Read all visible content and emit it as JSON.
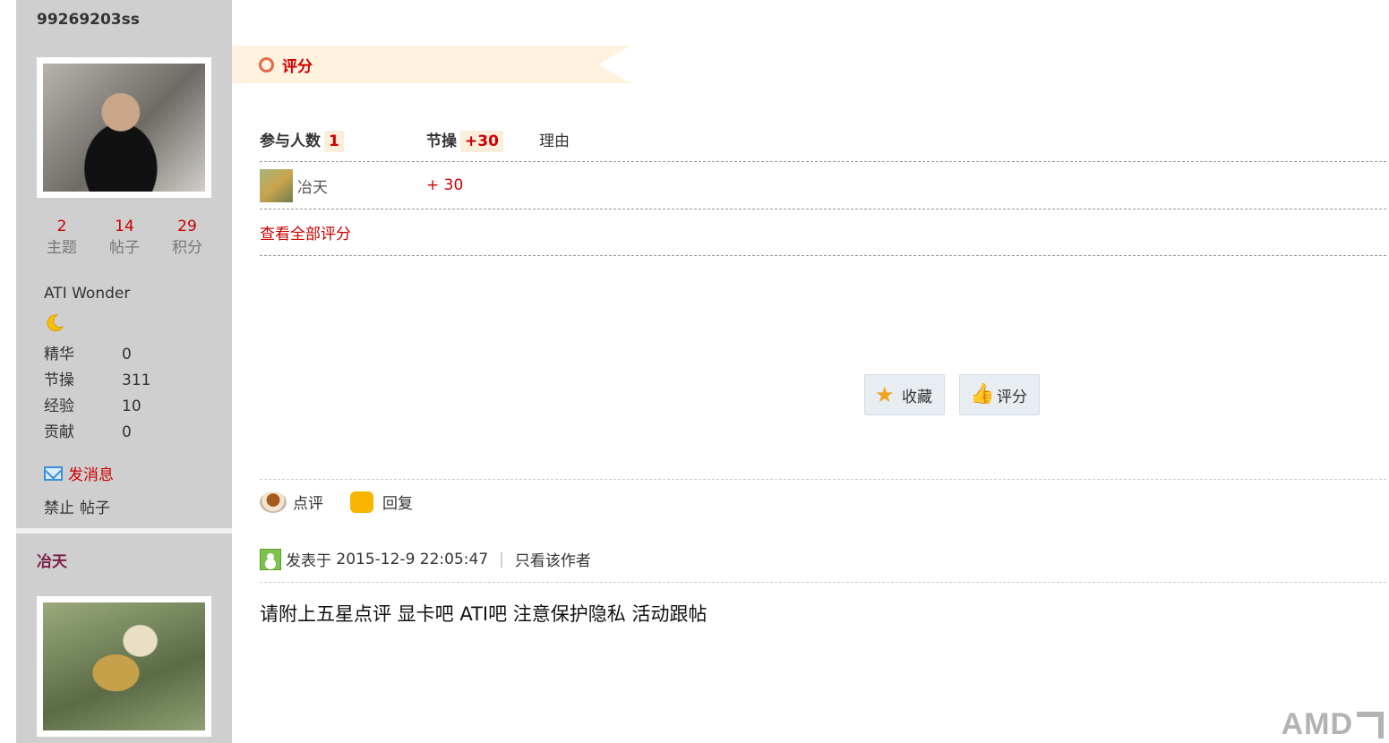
{
  "users": [
    {
      "name": "99269203ss",
      "stats": [
        {
          "value": "2",
          "label": "主题"
        },
        {
          "value": "14",
          "label": "帖子"
        },
        {
          "value": "29",
          "label": "积分"
        }
      ],
      "group": "ATI Wonder",
      "rank_icon": "moon-icon",
      "fields": [
        {
          "key": "精华",
          "value": "0"
        },
        {
          "key": "节操",
          "value": "311"
        },
        {
          "key": "经验",
          "value": "10"
        },
        {
          "key": "贡献",
          "value": "0"
        }
      ],
      "send_message": "发消息",
      "ban": "禁止",
      "posts": "帖子"
    },
    {
      "name": "冶天"
    }
  ],
  "rating": {
    "title": "评分",
    "participants_label": "参与人数",
    "participants_count": "1",
    "jiecao_label": "节操",
    "jiecao_total": "+30",
    "reason_label": "理由",
    "rows": [
      {
        "user": "冶天",
        "score": "+ 30"
      }
    ],
    "view_all": "查看全部评分"
  },
  "actions": {
    "favorite": "收藏",
    "rate": "评分",
    "comment": "点评",
    "reply": "回复"
  },
  "post2": {
    "posted_prefix": "发表于",
    "posted_time": "2015-12-9 22:05:47",
    "only_author": "只看该作者",
    "body": "请附上五星点评 显卡吧 ATI吧 注意保护隐私 活动跟帖"
  },
  "watermark": "AMD"
}
